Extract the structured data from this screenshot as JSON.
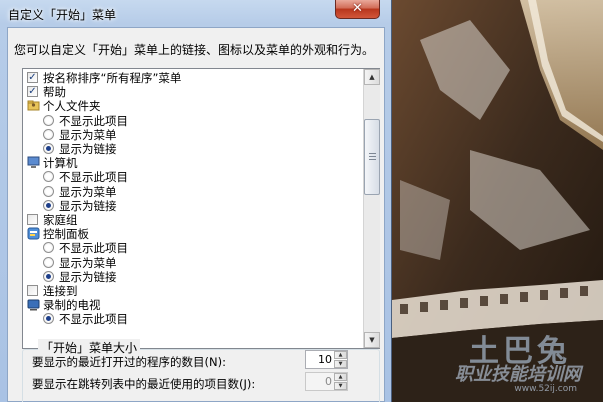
{
  "window": {
    "title": "自定义「开始」菜单",
    "close_glyph": "✕"
  },
  "instructions": "您可以自定义「开始」菜单上的链接、图标以及菜单的外观和行为。",
  "options": [
    {
      "kind": "checkbox",
      "checked": true,
      "label": "按名称排序“所有程序”菜单",
      "level": 0
    },
    {
      "kind": "checkbox",
      "checked": true,
      "label": "帮助",
      "level": 0
    },
    {
      "kind": "folder-icon",
      "label": "个人文件夹",
      "level": 0
    },
    {
      "kind": "radio",
      "checked": false,
      "label": "不显示此项目",
      "level": 1
    },
    {
      "kind": "radio",
      "checked": false,
      "label": "显示为菜单",
      "level": 1
    },
    {
      "kind": "radio",
      "checked": true,
      "label": "显示为链接",
      "level": 1
    },
    {
      "kind": "computer-icon",
      "label": "计算机",
      "level": 0
    },
    {
      "kind": "radio",
      "checked": false,
      "label": "不显示此项目",
      "level": 1
    },
    {
      "kind": "radio",
      "checked": false,
      "label": "显示为菜单",
      "level": 1
    },
    {
      "kind": "radio",
      "checked": true,
      "label": "显示为链接",
      "level": 1
    },
    {
      "kind": "checkbox",
      "checked": false,
      "label": "家庭组",
      "level": 0
    },
    {
      "kind": "control-panel-icon",
      "label": "控制面板",
      "level": 0
    },
    {
      "kind": "radio",
      "checked": false,
      "label": "不显示此项目",
      "level": 1
    },
    {
      "kind": "radio",
      "checked": false,
      "label": "显示为菜单",
      "level": 1
    },
    {
      "kind": "radio",
      "checked": true,
      "label": "显示为链接",
      "level": 1
    },
    {
      "kind": "checkbox",
      "checked": false,
      "label": "连接到",
      "level": 0
    },
    {
      "kind": "tv-icon",
      "label": "录制的电视",
      "level": 0
    },
    {
      "kind": "radio",
      "checked": true,
      "label": "不显示此项目",
      "level": 1
    }
  ],
  "start_menu_size": {
    "group_title": "「开始」菜单大小",
    "recent_programs_label": "要显示的最近打开过的程序的数目(N):",
    "recent_programs_value": "10",
    "jump_list_label": "要显示在跳转列表中的最近使用的项目数(J):",
    "jump_list_value": "0"
  },
  "watermark": {
    "brand": "土巴兔",
    "slogan": "职业技能培训网",
    "url": "www.52ij.com"
  },
  "colors": {
    "accent": "#1e3f8a",
    "close_button": "#c8452b",
    "client_bg": "#f0f0f0"
  }
}
